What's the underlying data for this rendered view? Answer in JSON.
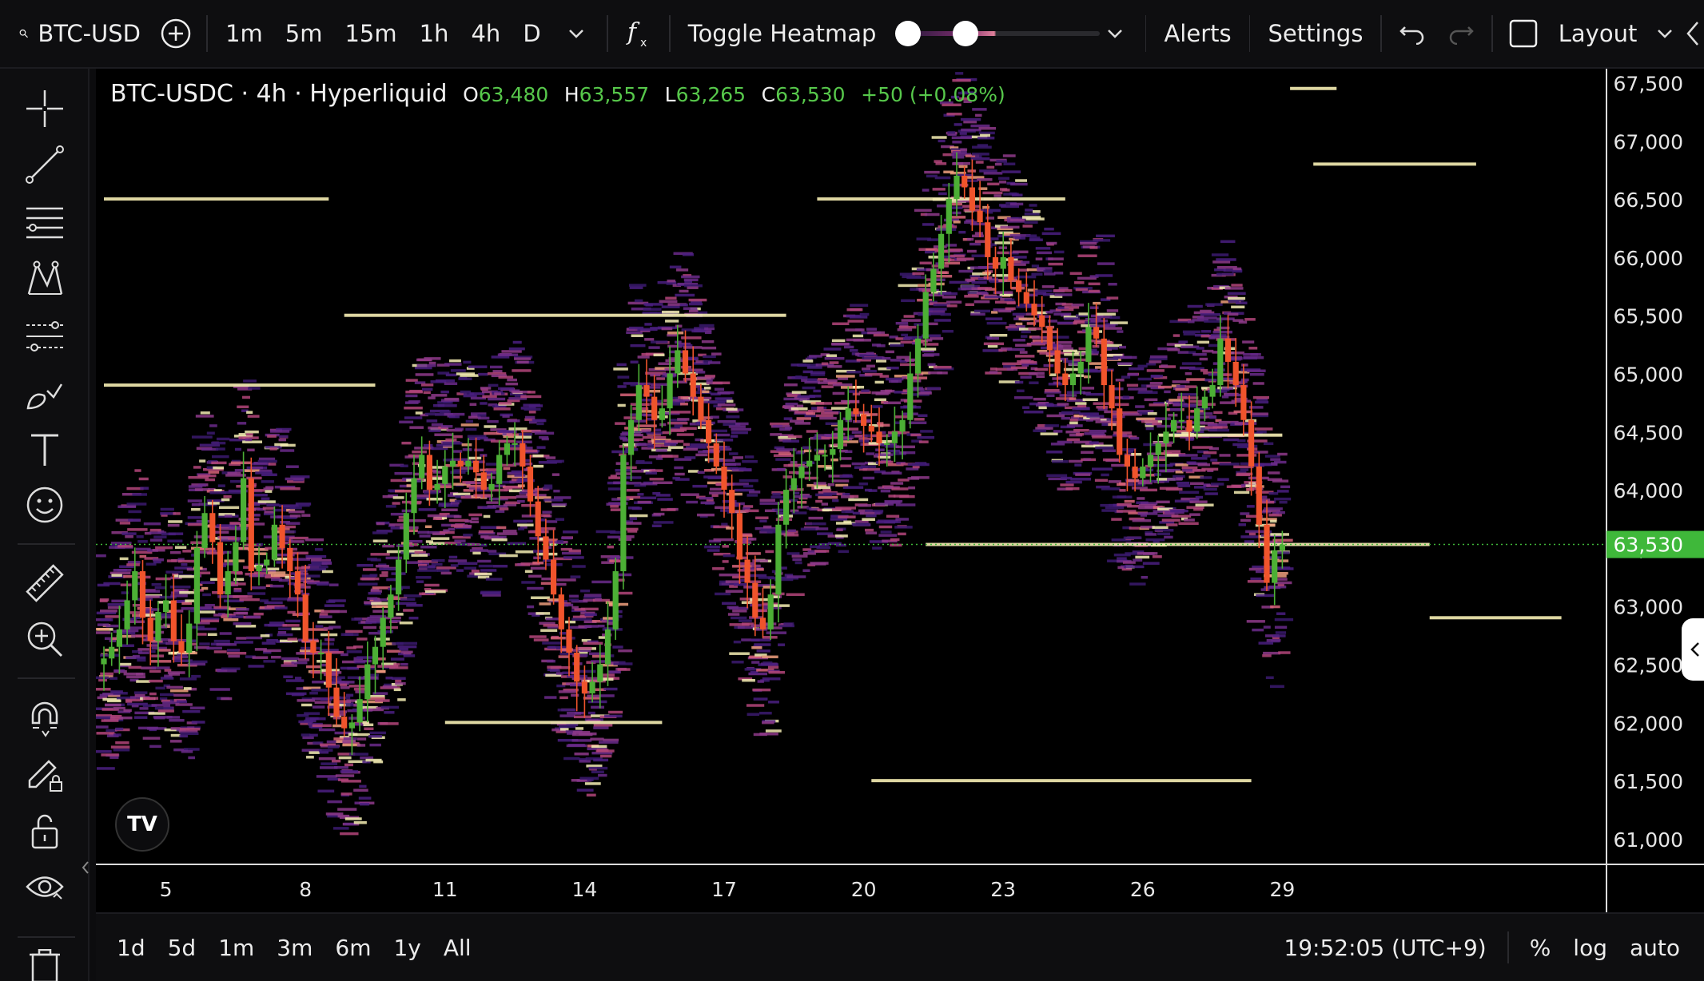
{
  "toolbar": {
    "symbol": "BTC-USD",
    "intervals": [
      "1m",
      "5m",
      "15m",
      "1h",
      "4h",
      "D"
    ],
    "toggle_heatmap": "Toggle Heatmap",
    "heatmap_level": 0.3,
    "alerts": "Alerts",
    "settings": "Settings",
    "layout": "Layout"
  },
  "legend": {
    "title": "BTC-USDC · 4h · Hyperliquid",
    "o_label": "O",
    "o": "63,480",
    "h_label": "H",
    "h": "63,557",
    "l_label": "L",
    "l": "63,265",
    "c_label": "C",
    "c": "63,530",
    "change": "+50 (+0.08%)"
  },
  "tv_logo": "TV",
  "bottom": {
    "ranges": [
      "1d",
      "5d",
      "1m",
      "3m",
      "6m",
      "1y",
      "All"
    ],
    "time": "19:52:05 (UTC+9)",
    "percent": "%",
    "log": "log",
    "auto": "auto"
  },
  "colors": {
    "up": "#4caf35",
    "down": "#f0542c",
    "last_price": "#3fb83a",
    "heat_low": "#3b1a6e",
    "heat_mid": "#b3457a",
    "heat_high": "#f6eeb4"
  },
  "chart_data": {
    "type": "candlestick",
    "symbol": "BTC-USDC",
    "interval": "4h",
    "exchange": "Hyperliquid",
    "y_ticks": [
      67500,
      67000,
      66500,
      66000,
      65500,
      65000,
      64500,
      64000,
      63500,
      63000,
      62500,
      62000,
      61500,
      61000
    ],
    "y_range": [
      60780,
      67620
    ],
    "x_ticks": [
      "5",
      "8",
      "11",
      "14",
      "17",
      "20",
      "23",
      "26",
      "29"
    ],
    "x_tick_index": [
      8,
      26,
      44,
      62,
      80,
      98,
      116,
      134,
      152
    ],
    "last_price": 63530,
    "last_price_label": "63,530",
    "closes": [
      62550,
      62650,
      62800,
      63050,
      63300,
      62900,
      62700,
      62950,
      63050,
      62700,
      62600,
      62850,
      63500,
      63800,
      63550,
      63100,
      63300,
      63550,
      64100,
      63300,
      63350,
      63400,
      63700,
      63500,
      63300,
      63100,
      62700,
      62600,
      62600,
      62300,
      62050,
      61950,
      62000,
      62200,
      62500,
      62650,
      62900,
      63100,
      63400,
      63800,
      64100,
      64300,
      64000,
      64050,
      64200,
      64250,
      64200,
      64250,
      64150,
      64000,
      64050,
      64300,
      64400,
      64400,
      64200,
      63900,
      63600,
      63400,
      63100,
      62800,
      62600,
      62350,
      62250,
      62350,
      62500,
      62800,
      63300,
      64300,
      64600,
      64900,
      64800,
      64600,
      64700,
      65000,
      65200,
      65000,
      64800,
      64600,
      64400,
      64200,
      64000,
      63800,
      63400,
      63200,
      62900,
      62800,
      63100,
      63700,
      64000,
      64100,
      64200,
      64250,
      64300,
      64300,
      64350,
      64600,
      64700,
      64650,
      64550,
      64500,
      64400,
      64400,
      64500,
      64600,
      65000,
      65300,
      65700,
      65900,
      66200,
      66500,
      66700,
      66600,
      66400,
      66300,
      66000,
      65900,
      66000,
      65800,
      65700,
      65600,
      65500,
      65400,
      65200,
      65000,
      64900,
      65000,
      65100,
      65400,
      65300,
      64900,
      64700,
      64300,
      64200,
      64100,
      64200,
      64300,
      64400,
      64500,
      64600,
      64600,
      64500,
      64700,
      64800,
      64900,
      65300,
      65100,
      64900,
      64600,
      64200,
      63700,
      63200,
      63480,
      63530
    ],
    "heat_bands": [
      {
        "price": 66500,
        "from": 0,
        "to": 29
      },
      {
        "price": 66500,
        "from": 92,
        "to": 124
      },
      {
        "price": 65500,
        "from": 31,
        "to": 88
      },
      {
        "price": 63530,
        "from": 106,
        "to": 171
      },
      {
        "price": 62900,
        "from": 171,
        "to": 188
      },
      {
        "price": 61500,
        "from": 99,
        "to": 148
      },
      {
        "price": 62000,
        "from": 44,
        "to": 72
      },
      {
        "price": 64470,
        "from": 136,
        "to": 152
      },
      {
        "price": 66800,
        "from": 156,
        "to": 177
      },
      {
        "price": 67450,
        "from": 153,
        "to": 159
      },
      {
        "price": 64900,
        "from": 0,
        "to": 35
      }
    ]
  }
}
